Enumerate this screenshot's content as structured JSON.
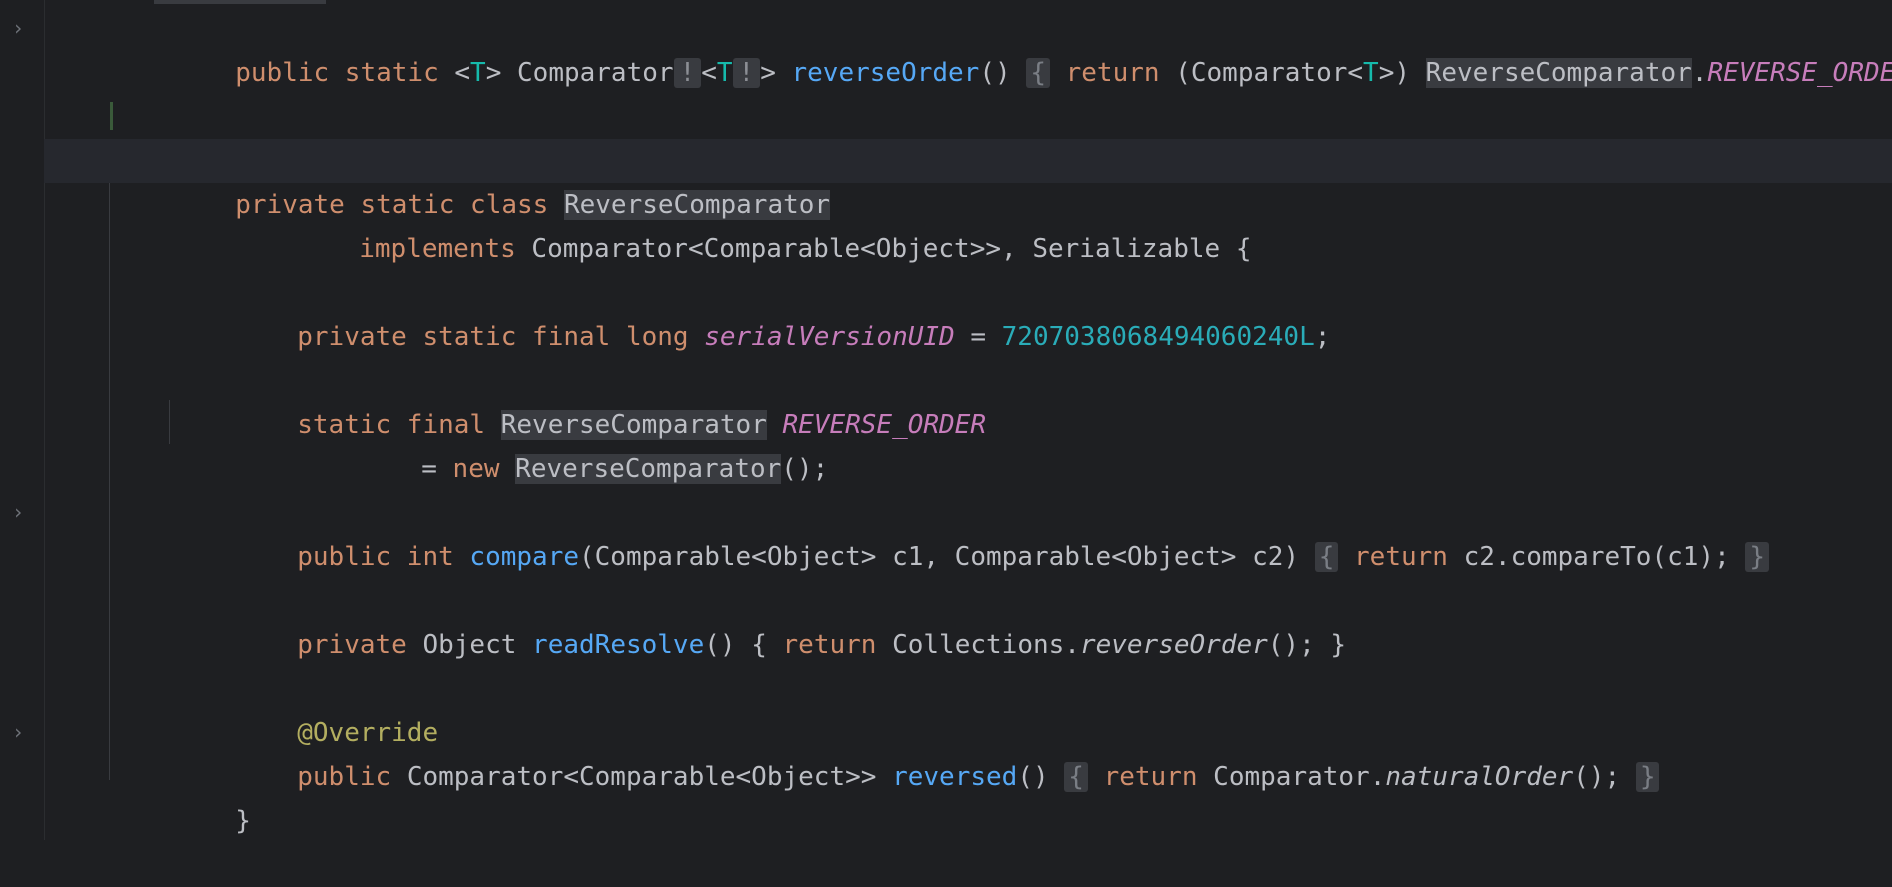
{
  "editor": {
    "lines": {
      "l1": {
        "a": "public static ",
        "lt": "<",
        "t1": "T",
        "gt": "> ",
        "comparator": "Comparator",
        "bang1": "!",
        "lt2": "<",
        "t2": "T",
        "bang2": "!",
        "gt2": "> ",
        "method": "reverseOrder",
        "paren": "()",
        "ob": "{",
        "ret": " return ",
        "cast1": "(Comparator<",
        "t3": "T",
        "cast2": ">) ",
        "cls": "ReverseComparator",
        "dot": ".",
        "field": "REVERSE_ORDER",
        "semi": ";",
        "cb": "}"
      },
      "l4": {
        "kw": "private static class ",
        "cls": "ReverseComparator"
      },
      "l5": {
        "kw": "implements ",
        "rest": "Comparator<Comparable<Object>>, Serializable {"
      },
      "l7": {
        "kw": "private static final long ",
        "field": "serialVersionUID",
        "eq": " = ",
        "num": "7207038068494060240L",
        "semi": ";"
      },
      "l9": {
        "kw": "static final ",
        "cls": "ReverseComparator",
        "sp": " ",
        "field": "REVERSE_ORDER"
      },
      "l10": {
        "eq": "= ",
        "kw": "new ",
        "cls": "ReverseComparator",
        "rest": "();"
      },
      "l12": {
        "kw": "public int ",
        "method": "compare",
        "params": "(Comparable<Object> c1, Comparable<Object> c2)",
        "ob": "{",
        "ret": " return ",
        "body": "c2.compareTo(c1);",
        "cb": "}"
      },
      "l14": {
        "kw": "private ",
        "type": "Object ",
        "method": "readResolve",
        "p": "() { ",
        "ret": "return ",
        "cls": "Collections.",
        "call": "reverseOrder",
        "end": "(); }"
      },
      "l16": {
        "ann": "@Override"
      },
      "l17": {
        "kw": "public ",
        "type": "Comparator<Comparable<Object>> ",
        "method": "reversed",
        "p": "()",
        "ob": "{",
        "ret": " return ",
        "cls": "Comparator.",
        "call": "naturalOrder",
        "end": "();",
        "cb": "}"
      },
      "l18": {
        "brace": "}"
      }
    },
    "fold_icon": "chevron-right-icon"
  }
}
